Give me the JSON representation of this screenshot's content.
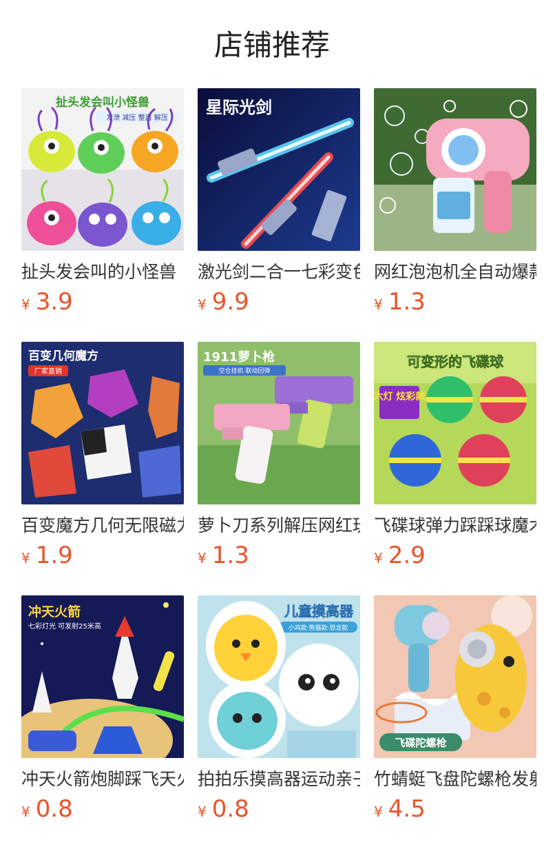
{
  "header": {
    "title": "店铺推荐"
  },
  "products": [
    {
      "name": "扯头发会叫的小怪兽",
      "currency": "¥",
      "price": "3.9",
      "image_text": "扯头发会叫小怪兽",
      "image_subtext": "发泄 减压 整蛊 解压",
      "colors": [
        "#f5f5f5",
        "#e9e6ea",
        "#c6dd3a",
        "#e84c8f",
        "#7b4fc9"
      ]
    },
    {
      "name": "激光剑二合一七彩变色",
      "currency": "¥",
      "price": "9.9",
      "image_text": "星际光剑",
      "image_subtext": "",
      "colors": [
        "#0b0f3a",
        "#1a2f7a",
        "#39c1ff",
        "#ff4a4a",
        "#d7f2ff"
      ]
    },
    {
      "name": "网红泡泡机全自动爆款",
      "currency": "¥",
      "price": "1.3",
      "image_text": "",
      "image_subtext": "",
      "colors": [
        "#2e5a26",
        "#9fb88a",
        "#f6b2c4",
        "#ffffff",
        "#e87592"
      ]
    },
    {
      "name": "百变魔方几何无限磁力",
      "currency": "¥",
      "price": "1.9",
      "image_text": "百变几何魔方",
      "image_subtext": "厂家直销",
      "colors": [
        "#1c2a6e",
        "#3b55b8",
        "#d04cc8",
        "#f2a23a",
        "#e14a3a"
      ]
    },
    {
      "name": "萝卜刀系列解压网红玩具",
      "currency": "¥",
      "price": "1.3",
      "image_text": "1911萝卜枪",
      "image_subtext": "空仓挂机 联动回弹",
      "colors": [
        "#6aa84f",
        "#a9d08e",
        "#9b6fd6",
        "#f2a7c3",
        "#c8e26a"
      ]
    },
    {
      "name": "飞碟球弹力踩踩球魔术球",
      "currency": "¥",
      "price": "2.9",
      "image_text": "可变形的飞碟球",
      "image_subtext": "六灯 炫彩款",
      "colors": [
        "#b5d85a",
        "#dff0a0",
        "#2f67d8",
        "#e0415a",
        "#8a2cc0"
      ]
    },
    {
      "name": "冲天火箭炮脚踩飞天火箭",
      "currency": "¥",
      "price": "0.8",
      "image_text": "冲天火箭",
      "image_subtext": "七彩灯光 可发射25米高",
      "colors": [
        "#141a55",
        "#2b3580",
        "#f0d27a",
        "#e63a2e",
        "#5adf4a"
      ]
    },
    {
      "name": "拍拍乐摸高器运动亲子玩具",
      "currency": "¥",
      "price": "0.8",
      "image_text": "儿童摸高器",
      "image_subtext": "小鸡款·熊猫款·恐龙款",
      "colors": [
        "#bfe2ec",
        "#e8f5f8",
        "#ffd23a",
        "#ffffff",
        "#5ac4b9"
      ]
    },
    {
      "name": "竹蜻蜓飞盘陀螺枪发射器",
      "currency": "¥",
      "price": "4.5",
      "image_text": "飞碟陀螺枪",
      "image_subtext": "",
      "colors": [
        "#f3c9b5",
        "#f8e5dc",
        "#7ec9e0",
        "#f7c93a",
        "#ffffff"
      ]
    }
  ]
}
